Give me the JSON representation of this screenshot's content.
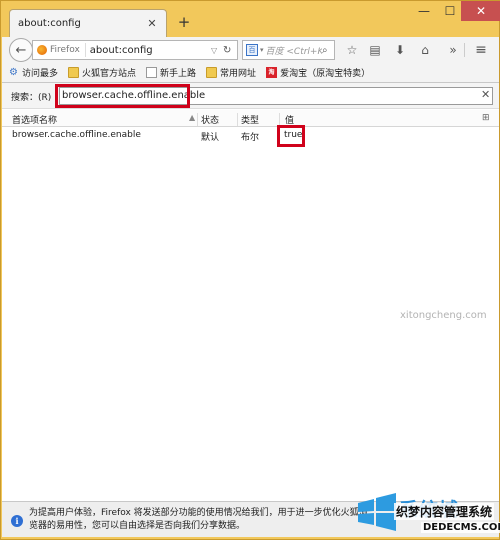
{
  "tab": {
    "title": "about:config"
  },
  "window_controls": {
    "minimize": "—",
    "maximize": "☐",
    "close": "✕"
  },
  "nav": {
    "identity_label": "Firefox",
    "url": "about:config",
    "search_placeholder": "百度 <Ctrl+K>"
  },
  "bookmarks": [
    {
      "label": "访问最多",
      "icon": "gear-icon"
    },
    {
      "label": "火狐官方站点",
      "icon": "folder-icon"
    },
    {
      "label": "新手上路",
      "icon": "page-icon"
    },
    {
      "label": "常用网址",
      "icon": "folder-icon"
    },
    {
      "label": "爱淘宝（原淘宝特卖）",
      "icon": "taobao-icon"
    }
  ],
  "filter": {
    "label": "搜索：(R)",
    "value": "browser.cache.offline.enable"
  },
  "columns": {
    "name": "首选项名称",
    "state": "状态",
    "type": "类型",
    "value": "值"
  },
  "rows": [
    {
      "name": "browser.cache.offline.enable",
      "state": "默认",
      "type": "布尔",
      "value": "true"
    }
  ],
  "notice": {
    "text": "为提高用户体验，Firefox 将发送部分功能的使用情况给我们，用于进一步优化火狐浏览器的易用性，您可以自由选择是否向我们分享数据。"
  },
  "watermark": {
    "big": "系统城",
    "small": "织梦内容管理系统",
    "url": "DEDECMS.COM",
    "site": "xitongcheng.com"
  },
  "colors": {
    "highlight": "#d0021b",
    "chrome": "#f2c85b"
  }
}
